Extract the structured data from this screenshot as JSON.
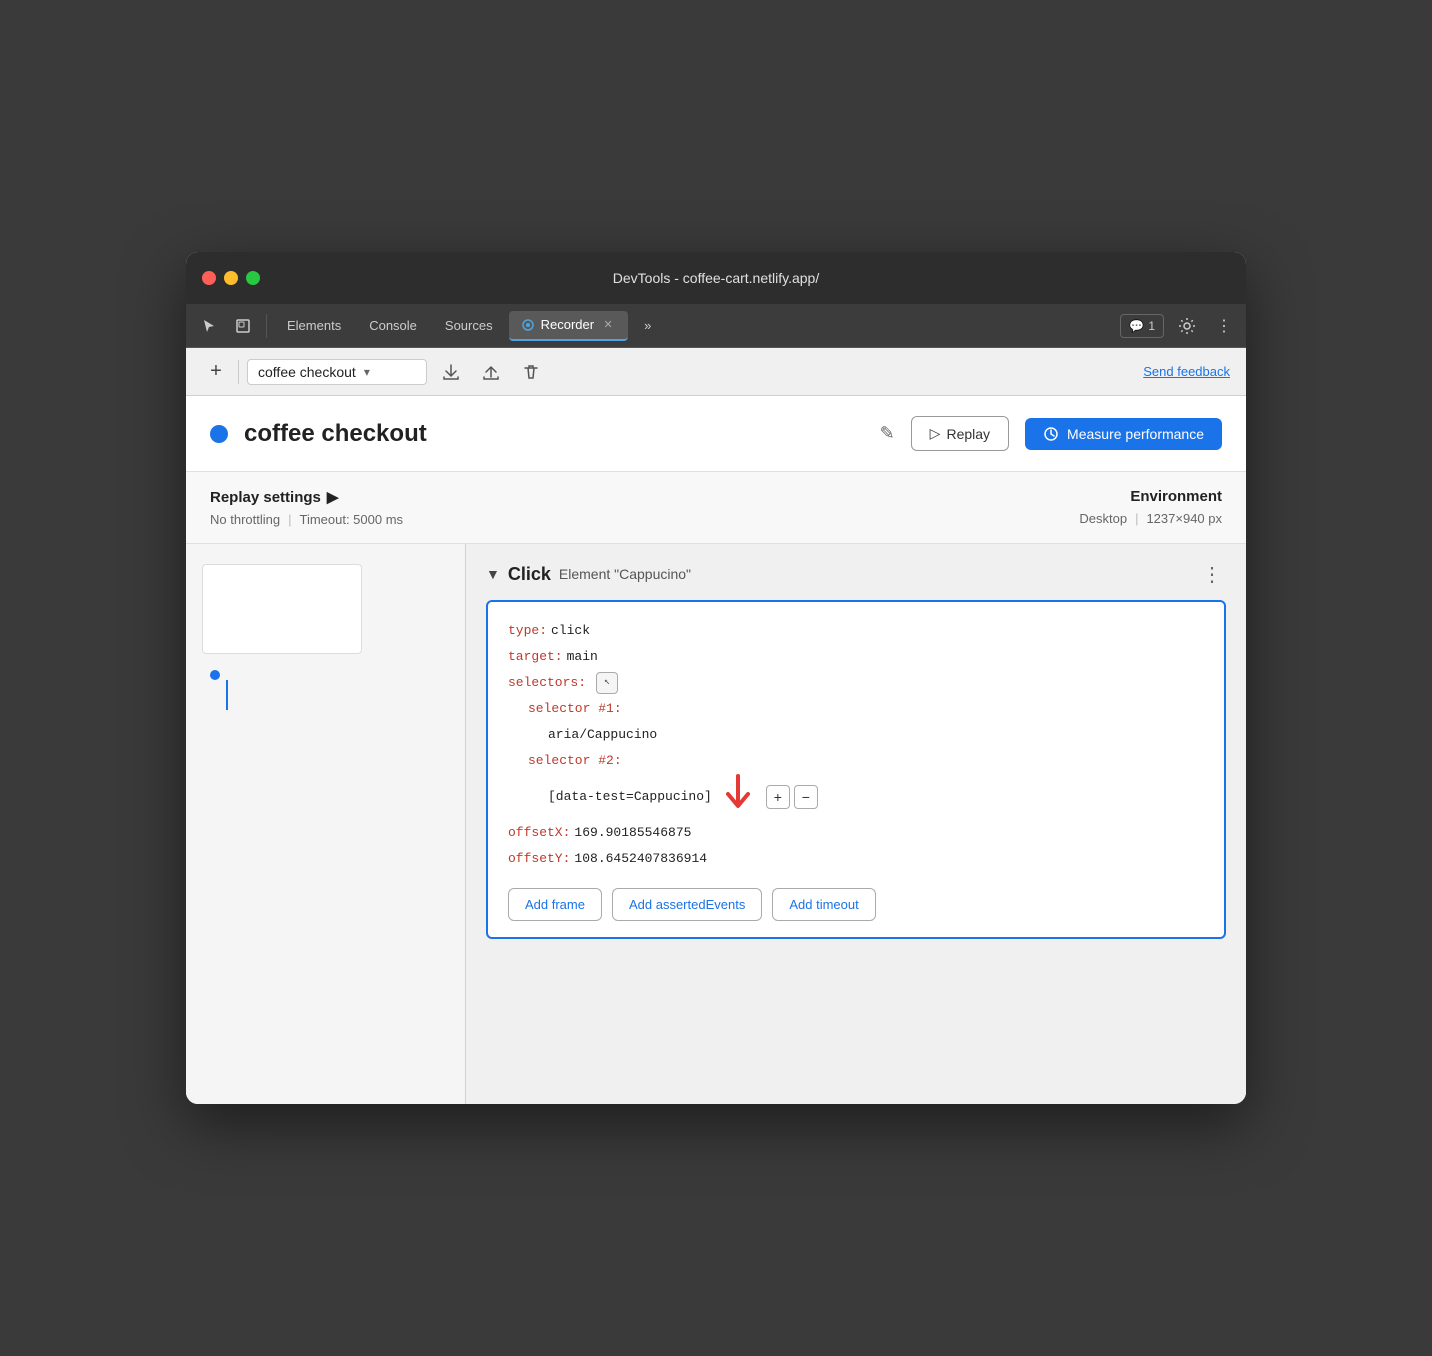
{
  "window": {
    "title": "DevTools - coffee-cart.netlify.app/"
  },
  "tabs": [
    {
      "label": "Elements",
      "active": false
    },
    {
      "label": "Console",
      "active": false
    },
    {
      "label": "Sources",
      "active": false
    },
    {
      "label": "Recorder",
      "active": true,
      "closable": true
    },
    {
      "label": "»",
      "active": false
    }
  ],
  "notification": {
    "icon": "💬",
    "count": "1"
  },
  "toolbar": {
    "add_label": "+",
    "recording_name": "coffee checkout",
    "send_feedback": "Send feedback"
  },
  "recording": {
    "title": "coffee checkout",
    "replay_label": "Replay",
    "measure_label": "Measure performance"
  },
  "settings": {
    "title": "Replay settings",
    "throttling": "No throttling",
    "timeout": "Timeout: 5000 ms",
    "env_title": "Environment",
    "env_type": "Desktop",
    "env_size": "1237×940 px"
  },
  "step": {
    "type": "Click",
    "element": "Element \"Cappucino\"",
    "code": {
      "type_key": "type:",
      "type_val": "click",
      "target_key": "target:",
      "target_val": "main",
      "selectors_key": "selectors:",
      "selector1_key": "selector #1:",
      "selector1_val": "aria/Cappucino",
      "selector2_key": "selector #2:",
      "selector2_val": "[data-test=Cappucino]",
      "offsetX_key": "offsetX:",
      "offsetX_val": "169.90185546875",
      "offsetY_key": "offsetY:",
      "offsetY_val": "108.6452407836914"
    }
  },
  "actions": {
    "add_frame": "Add frame",
    "add_asserted": "Add assertedEvents",
    "add_timeout": "Add timeout"
  },
  "icons": {
    "traffic_close": "●",
    "traffic_minimize": "●",
    "traffic_maximize": "●",
    "cursor": "↖",
    "square": "⊟",
    "more_tabs": "»",
    "gear": "⚙",
    "more_vert": "⋮",
    "plus": "+",
    "upload": "↑",
    "download": "↓",
    "trash": "🗑",
    "chevron_down": "▾",
    "pencil": "✎",
    "play": "▷",
    "settings_arrow": "▶"
  }
}
